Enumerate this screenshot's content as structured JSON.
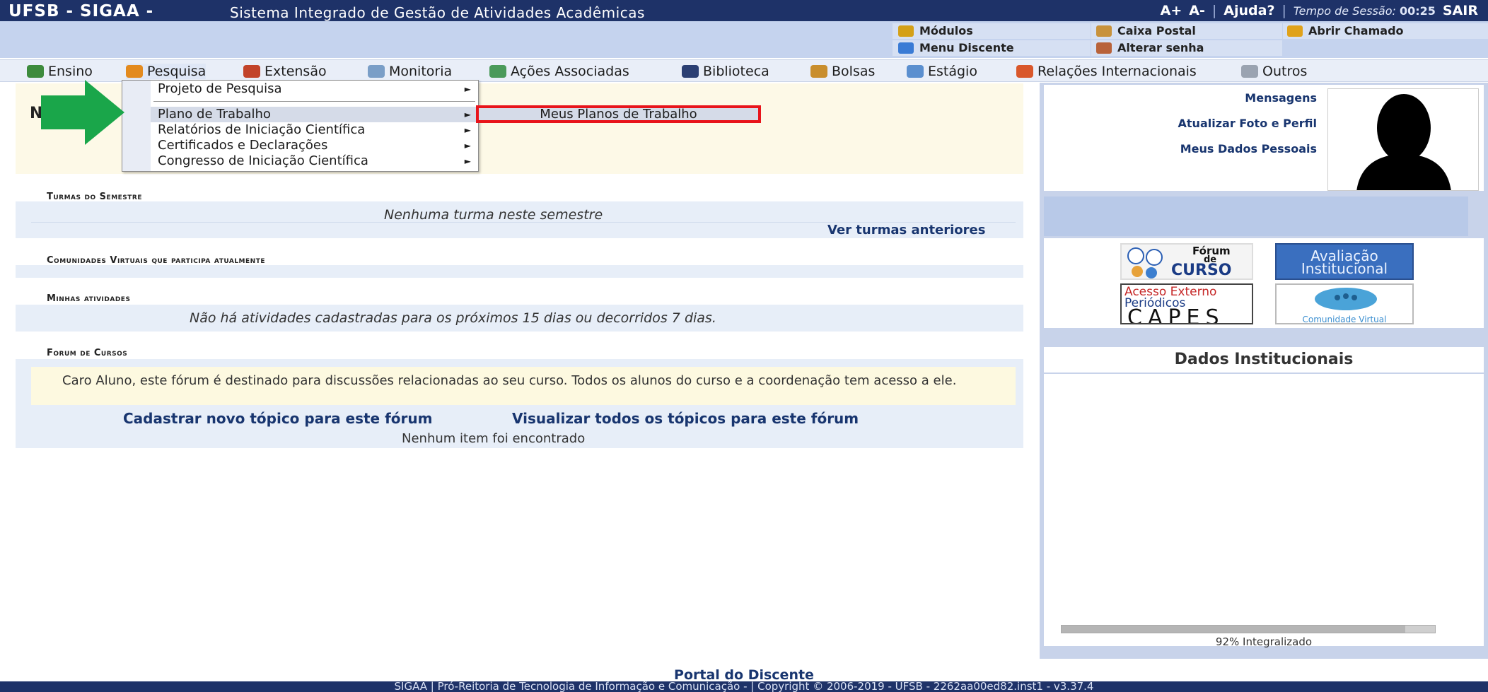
{
  "topbar": {
    "brand": "UFSB - SIGAA -",
    "system_name": "Sistema Integrado de Gestão de Atividades Acadêmicas",
    "font_plus": "A+",
    "font_minus": "A-",
    "help": "Ajuda?",
    "session_label": "Tempo de Sessão:",
    "session_time": "00:25",
    "logout": "SAIR"
  },
  "subbar": {
    "modules": "Módulos",
    "student_menu": "Menu Discente",
    "mailbox": "Caixa Postal",
    "change_password": "Alterar senha",
    "open_ticket": "Abrir Chamado"
  },
  "menu": {
    "items": [
      "Ensino",
      "Pesquisa",
      "Extensão",
      "Monitoria",
      "Ações Associadas",
      "Biblioteca",
      "Bolsas",
      "Estágio",
      "Relações Internacionais",
      "Outros"
    ]
  },
  "dropdown": {
    "items": [
      "Projeto de Pesquisa",
      "Plano de Trabalho",
      "Relatórios de Iniciação Científica",
      "Certificados e Declarações",
      "Congresso de Iniciação Científica"
    ],
    "arrow": "►",
    "submenu_item": "Meus Planos de Trabalho"
  },
  "main": {
    "greeting_initial": "N",
    "classes_title": "Turmas do Semestre",
    "no_classes": "Nenhuma turma neste semestre",
    "previous_classes": "Ver turmas anteriores",
    "communities_title": "Comunidades Virtuais que participa atualmente",
    "activities_title": "Minhas atividades",
    "no_activities": "Não há atividades cadastradas para os próximos 15 dias ou decorridos 7 dias.",
    "forum_title": "Forum de Cursos",
    "forum_note": "Caro Aluno, este fórum é destinado para discussões relacionadas ao seu curso. Todos os alunos do curso e a coordenação tem acesso a ele.",
    "new_topic": "Cadastrar novo tópico para este fórum",
    "view_topics": "Visualizar todos os tópicos para este fórum",
    "no_items": "Nenhum item foi encontrado"
  },
  "right": {
    "messages": "Mensagens",
    "update_photo": "Atualizar Foto e Perfil",
    "personal_data": "Meus Dados Pessoais",
    "badges": {
      "forum_line1": "Fórum",
      "forum_line2": "de",
      "forum_line3": "CURSO",
      "eval_line1": "Avaliação",
      "eval_line2": "Institucional",
      "capes_line1": "Acesso Externo",
      "capes_line2": "Periódicos",
      "capes_line3": "CAPES",
      "community": "Comunidade Virtual"
    },
    "institutional_title": "Dados Institucionais",
    "progress_percent": 92,
    "progress_label": "92% Integralizado"
  },
  "footer": {
    "portal": "Portal do Discente",
    "copyright": "SIGAA | Pró-Reitoria de Tecnologia de Informação e Comunicação -  | Copyright © 2006-2019 - UFSB - 2262aa00ed82.inst1 - v3.37.4"
  },
  "colors": {
    "header_bg": "#1e3268",
    "highlight_border": "#e8141b",
    "arrow": "#1aa64a"
  }
}
